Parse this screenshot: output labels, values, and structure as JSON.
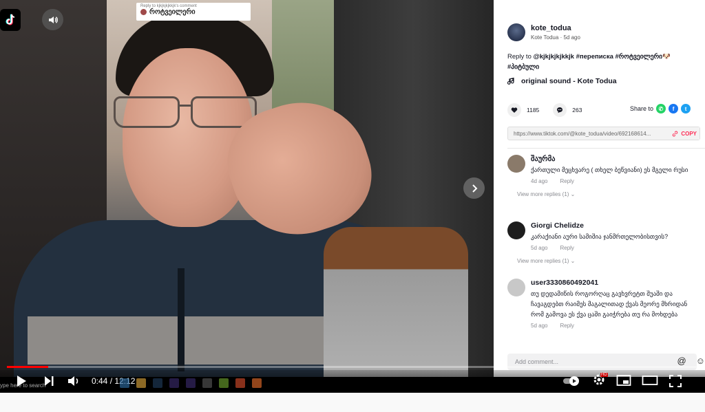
{
  "video": {
    "reply_tag_small": "Reply to kjkjkjkjkkjk's comment",
    "reply_tag_name": "როტვეილერი",
    "volume_icon": "speaker-icon",
    "next_icon": "chevron-right-icon"
  },
  "post": {
    "username": "kote_todua",
    "display_name": "Kote Todua",
    "age": "5d ago",
    "desc_prefix": "Reply to",
    "desc_tags": "@kjkjkjkjkkjk #переписка #როტვეილერი🐶 #პიტბული",
    "music": "original sound - Kote Todua",
    "likes": "1185",
    "comments_count": "263",
    "share_label": "Share to",
    "link": "https://www.tiktok.com/@kote_todua/video/692168614...",
    "copy_label": "COPY"
  },
  "comments": [
    {
      "name": "შაურმა",
      "text": "ქართული მეცხვარე ( თხელ ბეწვიანი) ეს მგელი რუსი",
      "age": "4d ago",
      "reply": "Reply",
      "more": "View more replies (1)",
      "avatar_color": "#8a7a6a"
    },
    {
      "name": "Giorgi Chelidze",
      "text": "კარაქიანი აური სამიშია ჯანმრთელობისთვის?",
      "age": "5d ago",
      "reply": "Reply",
      "more": "View more replies (1)",
      "avatar_color": "#1e1e1e"
    },
    {
      "name": "user3330860492041",
      "text": "თუ დედამიწის როგორღაც გავხვრეტთ შუაში და ჩავაგდებთ რაიმეს მაგალითად ქვას მეორე მხრიდან რომ გამოვა ეს ქვა ცაში გაიჭრება თუ რა მოხდება",
      "age": "5d ago",
      "reply": "Reply",
      "more": "",
      "avatar_color": "#c8c8c8"
    }
  ],
  "add_comment": {
    "placeholder": "Add comment..."
  },
  "player": {
    "time": "0:44 / 12:12",
    "progress": 0.06,
    "ghost_text": "ype here to search",
    "hd_badge": "HD"
  },
  "colors": {
    "accent": "#fe2c55",
    "progress": "#ff0000",
    "whatsapp": "#25d366",
    "facebook": "#1877f2",
    "twitter": "#1da1f2"
  }
}
